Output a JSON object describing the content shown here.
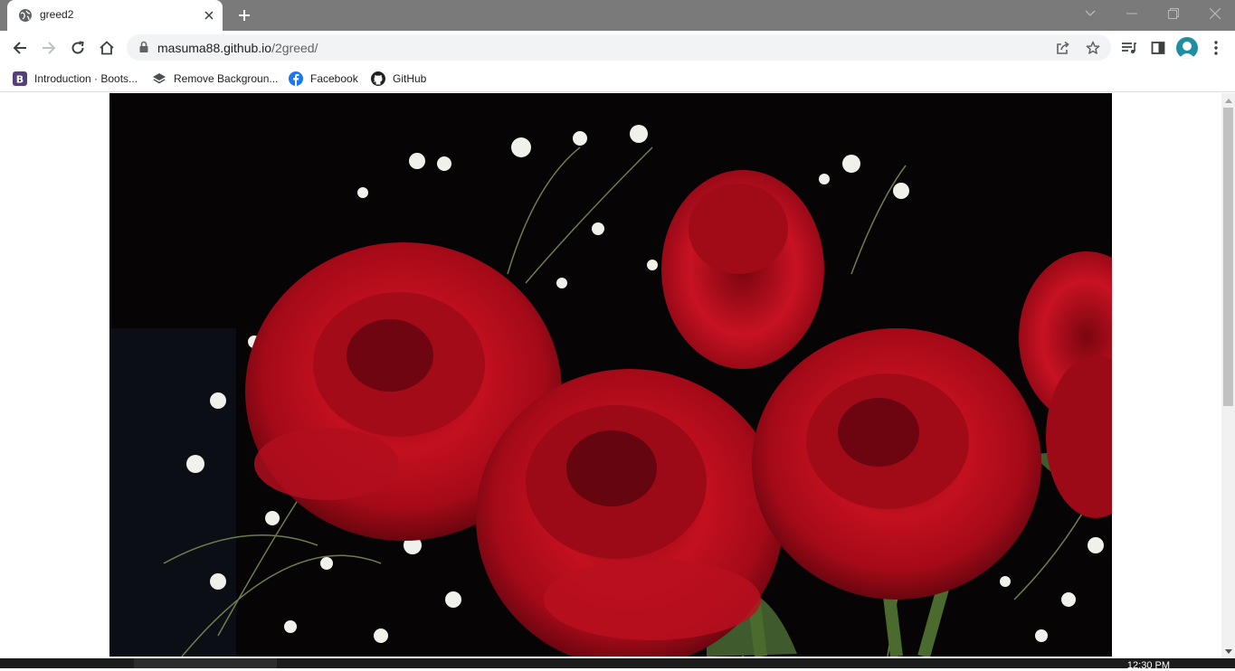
{
  "tab": {
    "title": "greed2",
    "favicon": "globe-icon"
  },
  "window_controls": [
    "minimize-icon",
    "restore-icon",
    "close-icon"
  ],
  "omnibox": {
    "host": "masuma88.github.io",
    "path": "/2greed/"
  },
  "bookmarks": [
    {
      "label": "Introduction · Boots...",
      "icon": "bootstrap-icon",
      "color": "#7952b3"
    },
    {
      "label": "Remove Backgroun...",
      "icon": "layers-icon",
      "color": "#4a4f54"
    },
    {
      "label": "Facebook",
      "icon": "facebook-icon",
      "color": "#1877f2"
    },
    {
      "label": "GitHub",
      "icon": "github-icon",
      "color": "#202124"
    }
  ],
  "content": {
    "image": "red-roses-photo"
  },
  "taskbar": {
    "clock": "12:30 PM"
  }
}
